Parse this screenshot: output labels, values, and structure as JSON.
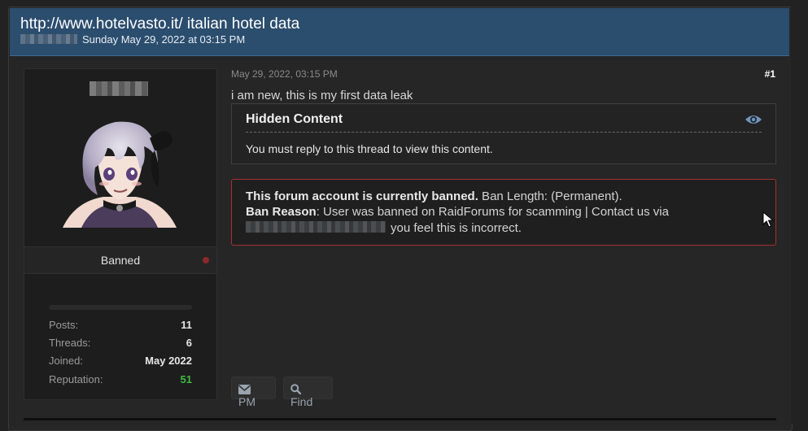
{
  "thread": {
    "title": "http://www.hotelvasto.it/ italian hotel data",
    "date": "Sunday May 29, 2022 at 03:15 PM"
  },
  "user": {
    "status": "Banned",
    "stats": [
      {
        "label": "Posts:",
        "value": "11"
      },
      {
        "label": "Threads:",
        "value": "6"
      },
      {
        "label": "Joined:",
        "value": "May 2022"
      },
      {
        "label": "Reputation:",
        "value": "51"
      }
    ]
  },
  "post": {
    "date": "May 29, 2022, 03:15 PM",
    "number": "#1",
    "text": "i am new, this is my first data leak",
    "hidden": {
      "title": "Hidden Content",
      "message": "You must reply to this thread to view this content."
    },
    "ban": {
      "headline": "This forum account is currently banned.",
      "length": " Ban Length: (Permanent).",
      "reason_label": "Ban Reason",
      "reason": ": User was banned on RaidForums for scamming | Contact us via",
      "suffix": "you feel this is incorrect."
    },
    "buttons": {
      "pm": "PM",
      "find": "Find"
    }
  },
  "colors": {
    "header": "#2b4d6e",
    "ban_border": "#a8302f",
    "reputation": "#3fb93f"
  },
  "icons": [
    "eye-icon",
    "envelope-icon",
    "search-icon",
    "cursor-icon"
  ]
}
